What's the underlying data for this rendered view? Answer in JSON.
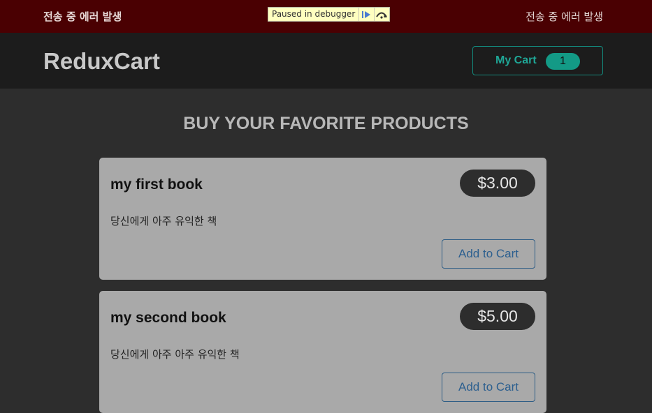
{
  "notification": {
    "left_text": "전송 중 에러 발생",
    "right_text": "전송 중 에러 발생",
    "color": "#4a0002"
  },
  "debugger": {
    "label": "Paused in debugger",
    "resume_icon": "resume-icon",
    "step_over_icon": "step-over-icon"
  },
  "header": {
    "brand": "ReduxCart",
    "cart_label": "My Cart",
    "cart_count": "1",
    "accent": "#139a86"
  },
  "main": {
    "heading": "BUY YOUR FAVORITE PRODUCTS",
    "products": [
      {
        "title": "my first book",
        "price": "$3.00",
        "description": "당신에게 아주 유익한 책",
        "button_label": "Add to Cart"
      },
      {
        "title": "my second book",
        "price": "$5.00",
        "description": "당신에게 아주 아주 유익한 책",
        "button_label": "Add to Cart"
      }
    ]
  }
}
